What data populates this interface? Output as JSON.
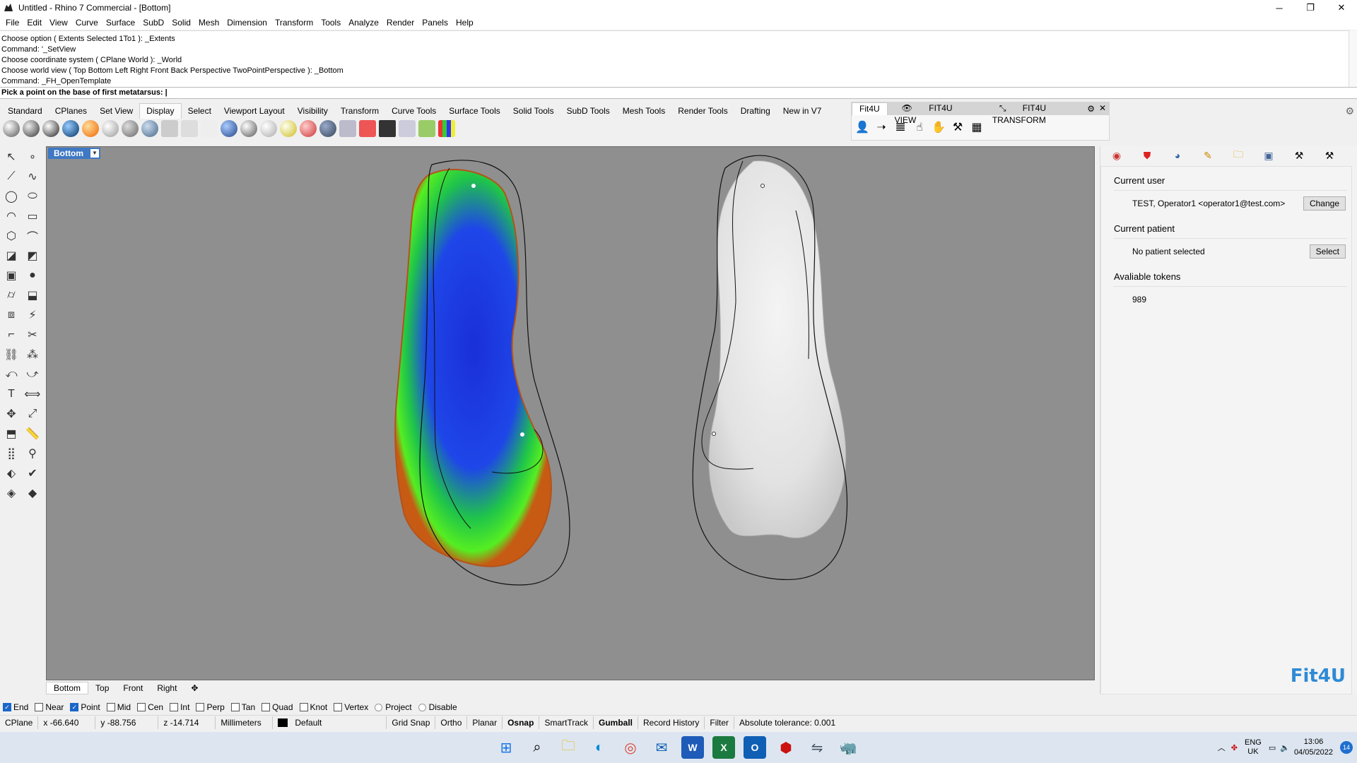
{
  "window": {
    "title": "Untitled - Rhino 7 Commercial - [Bottom]",
    "minimize": "─",
    "maximize": "❐",
    "close": "✕"
  },
  "menu": [
    "File",
    "Edit",
    "View",
    "Curve",
    "Surface",
    "SubD",
    "Solid",
    "Mesh",
    "Dimension",
    "Transform",
    "Tools",
    "Analyze",
    "Render",
    "Panels",
    "Help"
  ],
  "command_history": [
    "Choose option ( Extents  Selected  1To1 ): _Extents",
    "Command: '_SetView",
    "Choose coordinate system ( CPlane  World ): _World",
    "Choose world view ( Top  Bottom  Left  Right  Front  Back  Perspective  TwoPointPerspective ): _Bottom",
    "Command: _FH_OpenTemplate"
  ],
  "command_prompt": "Pick a point on the base of first metatarsus:",
  "toolbar_tabs": [
    "Standard",
    "CPlanes",
    "Set View",
    "Display",
    "Select",
    "Viewport Layout",
    "Visibility",
    "Transform",
    "Curve Tools",
    "Surface Tools",
    "Solid Tools",
    "SubD Tools",
    "Mesh Tools",
    "Render Tools",
    "Drafting",
    "New in V7"
  ],
  "toolbar_active_tab": "Display",
  "fit_tabs": [
    "Fit4U",
    "FIT4U VIEW",
    "FIT4U TRANSFORM"
  ],
  "viewport": {
    "label": "Bottom",
    "tabs": [
      "Bottom",
      "Top",
      "Front",
      "Right"
    ]
  },
  "panel": {
    "current_user_title": "Current user",
    "current_user": "TEST, Operator1 <operator1@test.com>",
    "change_btn": "Change",
    "current_patient_title": "Current patient",
    "current_patient": "No patient selected",
    "select_btn": "Select",
    "tokens_title": "Avaliable tokens",
    "tokens": "989",
    "logo": "Fit4U"
  },
  "osnap": [
    {
      "label": "End",
      "checked": true
    },
    {
      "label": "Near",
      "checked": false
    },
    {
      "label": "Point",
      "checked": true
    },
    {
      "label": "Mid",
      "checked": false
    },
    {
      "label": "Cen",
      "checked": false
    },
    {
      "label": "Int",
      "checked": false
    },
    {
      "label": "Perp",
      "checked": false
    },
    {
      "label": "Tan",
      "checked": false
    },
    {
      "label": "Quad",
      "checked": false
    },
    {
      "label": "Knot",
      "checked": false
    },
    {
      "label": "Vertex",
      "checked": false
    }
  ],
  "osnap_project": "Project",
  "osnap_disable": "Disable",
  "status": {
    "cplane": "CPlane",
    "x": "x -66.640",
    "y": "y -88.756",
    "z": "z -14.714",
    "units": "Millimeters",
    "layer": "Default",
    "grid_snap": "Grid Snap",
    "ortho": "Ortho",
    "planar": "Planar",
    "osnap": "Osnap",
    "smarttrack": "SmartTrack",
    "gumball": "Gumball",
    "record_history": "Record History",
    "filter": "Filter",
    "tolerance": "Absolute tolerance: 0.001"
  },
  "taskbar": {
    "lang1": "ENG",
    "lang2": "UK",
    "time": "13:06",
    "date": "04/05/2022",
    "notifications": "14"
  },
  "colors": {
    "viewport_bg": "#8f8f8f",
    "viewport_label": "#3f78c4",
    "accent": "#1a66c9",
    "logo": "#2f8ad6"
  }
}
